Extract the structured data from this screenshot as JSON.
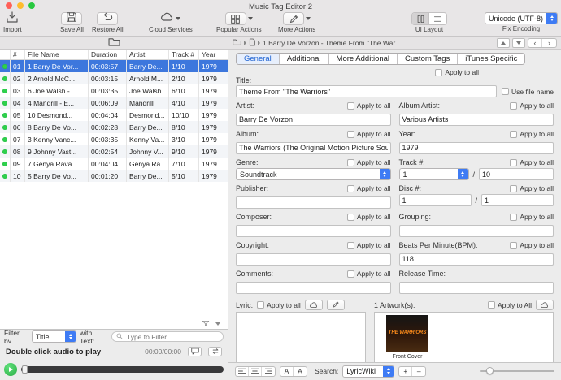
{
  "window": {
    "title": "Music Tag Editor 2"
  },
  "colors": {
    "accent_blue": "#3e7bf4",
    "selection_blue": "#3d77dd",
    "status_dot_green": "#2ed14d",
    "traffic_red": "#ff5f57",
    "traffic_yellow": "#febc2e",
    "traffic_green": "#28c840"
  },
  "icons": {
    "import": "tray-arrow-down",
    "save_all": "floppy-disk",
    "restore_all": "undo-arrow",
    "cloud": "cloud",
    "popular_actions": "grid",
    "more_actions": "pencil",
    "ui_layout_columns": "columns",
    "ui_layout_rows": "rows",
    "folder": "folder",
    "document": "document",
    "search": "magnifier",
    "funnel": "funnel",
    "comment": "speech-bubble",
    "loop": "loop-arrows",
    "play": "play-triangle",
    "up": "triangle-up",
    "down": "triangle-down",
    "back": "‹",
    "forward": "›",
    "plus": "+",
    "minus": "–",
    "font_small": "A",
    "font_large": "A",
    "align_left": "align-left-lines",
    "align_center": "align-center-lines",
    "align_right": "align-right-lines"
  },
  "toolbar": {
    "import_label": "Import",
    "save_all_label": "Save All",
    "restore_all_label": "Restore All",
    "cloud_services_label": "Cloud Services",
    "popular_actions_label": "Popular Actions",
    "more_actions_label": "More Actions",
    "ui_layout_label": "UI Layout",
    "encoding_value": "Unicode (UTF-8)",
    "fix_encoding_label": "Fix Encoding"
  },
  "breadcrumb": {
    "path": "1 Barry De Vorzon - Theme From \"The War..."
  },
  "table": {
    "columns": [
      "#",
      "File Name",
      "Duration",
      "Artist",
      "Track #",
      "Year"
    ],
    "rows": [
      {
        "num": "01",
        "file": "1 Barry De Vor...",
        "duration": "00:03:57",
        "artist": "Barry De...",
        "track": "1/10",
        "year": "1979",
        "selected": true
      },
      {
        "num": "02",
        "file": "2 Arnold McC...",
        "duration": "00:03:15",
        "artist": "Arnold M...",
        "track": "2/10",
        "year": "1979",
        "selected": false
      },
      {
        "num": "03",
        "file": "6 Joe Walsh -...",
        "duration": "00:03:35",
        "artist": "Joe Walsh",
        "track": "6/10",
        "year": "1979",
        "selected": false
      },
      {
        "num": "04",
        "file": "4 Mandrill - E...",
        "duration": "00:06:09",
        "artist": "Mandrill",
        "track": "4/10",
        "year": "1979",
        "selected": false
      },
      {
        "num": "05",
        "file": "10 Desmond...",
        "duration": "00:04:04",
        "artist": "Desmond...",
        "track": "10/10",
        "year": "1979",
        "selected": false
      },
      {
        "num": "06",
        "file": "8 Barry De Vo...",
        "duration": "00:02:28",
        "artist": "Barry De...",
        "track": "8/10",
        "year": "1979",
        "selected": false
      },
      {
        "num": "07",
        "file": "3 Kenny Vanc...",
        "duration": "00:03:35",
        "artist": "Kenny Va...",
        "track": "3/10",
        "year": "1979",
        "selected": false
      },
      {
        "num": "08",
        "file": "9 Johnny Vast...",
        "duration": "00:02:54",
        "artist": "Johnny V...",
        "track": "9/10",
        "year": "1979",
        "selected": false
      },
      {
        "num": "09",
        "file": "7 Genya Rava...",
        "duration": "00:04:04",
        "artist": "Genya Ra...",
        "track": "7/10",
        "year": "1979",
        "selected": false
      },
      {
        "num": "10",
        "file": "5 Barry De Vo...",
        "duration": "00:01:20",
        "artist": "Barry De...",
        "track": "5/10",
        "year": "1979",
        "selected": false
      }
    ]
  },
  "filter": {
    "label": "Filter by",
    "value": "Title",
    "with_text_label": "with Text:",
    "placeholder": "Type to Filter"
  },
  "player": {
    "hint": "Double click audio to play",
    "time": "00:00/00:00"
  },
  "tabs": {
    "items": [
      "General",
      "Additional",
      "More Additional",
      "Custom Tags",
      "iTunes Specific"
    ],
    "selected": "General"
  },
  "form": {
    "apply_to_all_label": "Apply to all",
    "apply_to_all_caps_label": "Apply to All",
    "use_file_name_label": "Use file name",
    "title": {
      "label": "Title:",
      "value": "Theme From \"The Warriors\""
    },
    "artist": {
      "label": "Artist:",
      "value": "Barry De Vorzon"
    },
    "album_artist": {
      "label": "Album Artist:",
      "value": "Various Artists"
    },
    "album": {
      "label": "Album:",
      "value": "The Warriors (The Original Motion Picture Sou"
    },
    "year": {
      "label": "Year:",
      "value": "1979"
    },
    "genre": {
      "label": "Genre:",
      "value": "Soundtrack"
    },
    "track": {
      "label": "Track #:",
      "value": "1",
      "total": "10",
      "separator": "/"
    },
    "publisher": {
      "label": "Publisher:",
      "value": ""
    },
    "disc": {
      "label": "Disc #:",
      "value": "1",
      "total": "1",
      "separator": "/"
    },
    "composer": {
      "label": "Composer:",
      "value": ""
    },
    "grouping": {
      "label": "Grouping:",
      "value": ""
    },
    "copyright": {
      "label": "Copyright:",
      "value": ""
    },
    "bpm": {
      "label": "Beats Per Minute(BPM):",
      "value": "118"
    },
    "comments": {
      "label": "Comments:",
      "value": ""
    },
    "release_time": {
      "label": "Release Time:",
      "value": ""
    },
    "lyric": {
      "label": "Lyric:",
      "value": ""
    },
    "artwork": {
      "label": "1 Artwork(s):",
      "caption": "Front Cover",
      "poster_text": "THE WARRIORS"
    },
    "search": {
      "label": "Search:",
      "value": "LyricWiki"
    }
  }
}
